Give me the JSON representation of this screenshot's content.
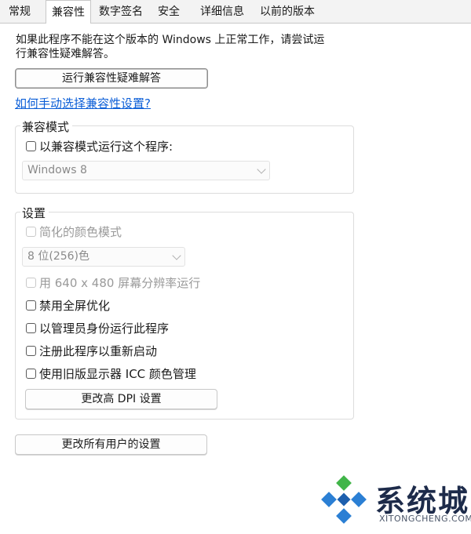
{
  "tabs": [
    {
      "label": "常规",
      "active": false
    },
    {
      "label": "兼容性",
      "active": true
    },
    {
      "label": "数字签名",
      "active": false
    },
    {
      "label": "安全",
      "active": false
    },
    {
      "label": "详细信息",
      "active": false
    },
    {
      "label": "以前的版本",
      "active": false
    }
  ],
  "compat": {
    "intro_line1": "如果此程序不能在这个版本的 Windows 上正常工作，请尝试运",
    "intro_line2": "行兼容性疑难解答。",
    "troubleshoot_button": "运行兼容性疑难解答",
    "manual_link": "如何手动选择兼容性设置?",
    "mode_group": {
      "title": "兼容模式",
      "checkbox_label": "以兼容模式运行这个程序:",
      "checked": false,
      "select_value": "Windows 8",
      "enabled": false
    },
    "settings_group": {
      "title": "设置",
      "reduced_color": {
        "label": "简化的颜色模式",
        "checked": false,
        "enabled": false
      },
      "color_select": {
        "value": "8 位(256)色",
        "enabled": false
      },
      "res_640": {
        "label": "用 640 x 480 屏幕分辨率运行",
        "checked": false,
        "enabled": false
      },
      "disable_fullscreen": {
        "label": "禁用全屏优化",
        "checked": false,
        "enabled": true
      },
      "run_as_admin": {
        "label": "以管理员身份运行此程序",
        "checked": false,
        "enabled": true
      },
      "register_restart": {
        "label": "注册此程序以重新启动",
        "checked": false,
        "enabled": true
      },
      "legacy_icc": {
        "label": "使用旧版显示器 ICC 颜色管理",
        "checked": false,
        "enabled": true
      },
      "dpi_button": "更改高 DPI 设置"
    },
    "all_users_button": "更改所有用户的设置"
  },
  "watermark": {
    "text": "系统城",
    "sub": "XITONGCHENG.COM",
    "colors": {
      "blue": "#2b7fd4",
      "green": "#41b549",
      "dark": "#1d2b4a"
    }
  }
}
